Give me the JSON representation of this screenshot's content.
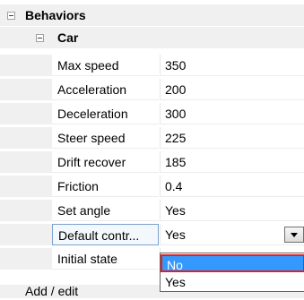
{
  "category": {
    "label": "Behaviors"
  },
  "subcategory": {
    "label": "Car"
  },
  "properties": [
    {
      "name": "Max speed",
      "value": "350"
    },
    {
      "name": "Acceleration",
      "value": "200"
    },
    {
      "name": "Deceleration",
      "value": "300"
    },
    {
      "name": "Steer speed",
      "value": "225"
    },
    {
      "name": "Drift recover",
      "value": "185"
    },
    {
      "name": "Friction",
      "value": "0.4"
    },
    {
      "name": "Set angle",
      "value": "Yes"
    },
    {
      "name": "Default contr...",
      "value": "Yes"
    },
    {
      "name": "Initial state",
      "value": ""
    }
  ],
  "dropdown": {
    "options": [
      "No",
      "Yes"
    ],
    "highlighted": "No"
  },
  "footer": {
    "label": "Add / edit"
  },
  "colors": {
    "selection": "#3399ff",
    "highlight_border": "#e02020"
  }
}
